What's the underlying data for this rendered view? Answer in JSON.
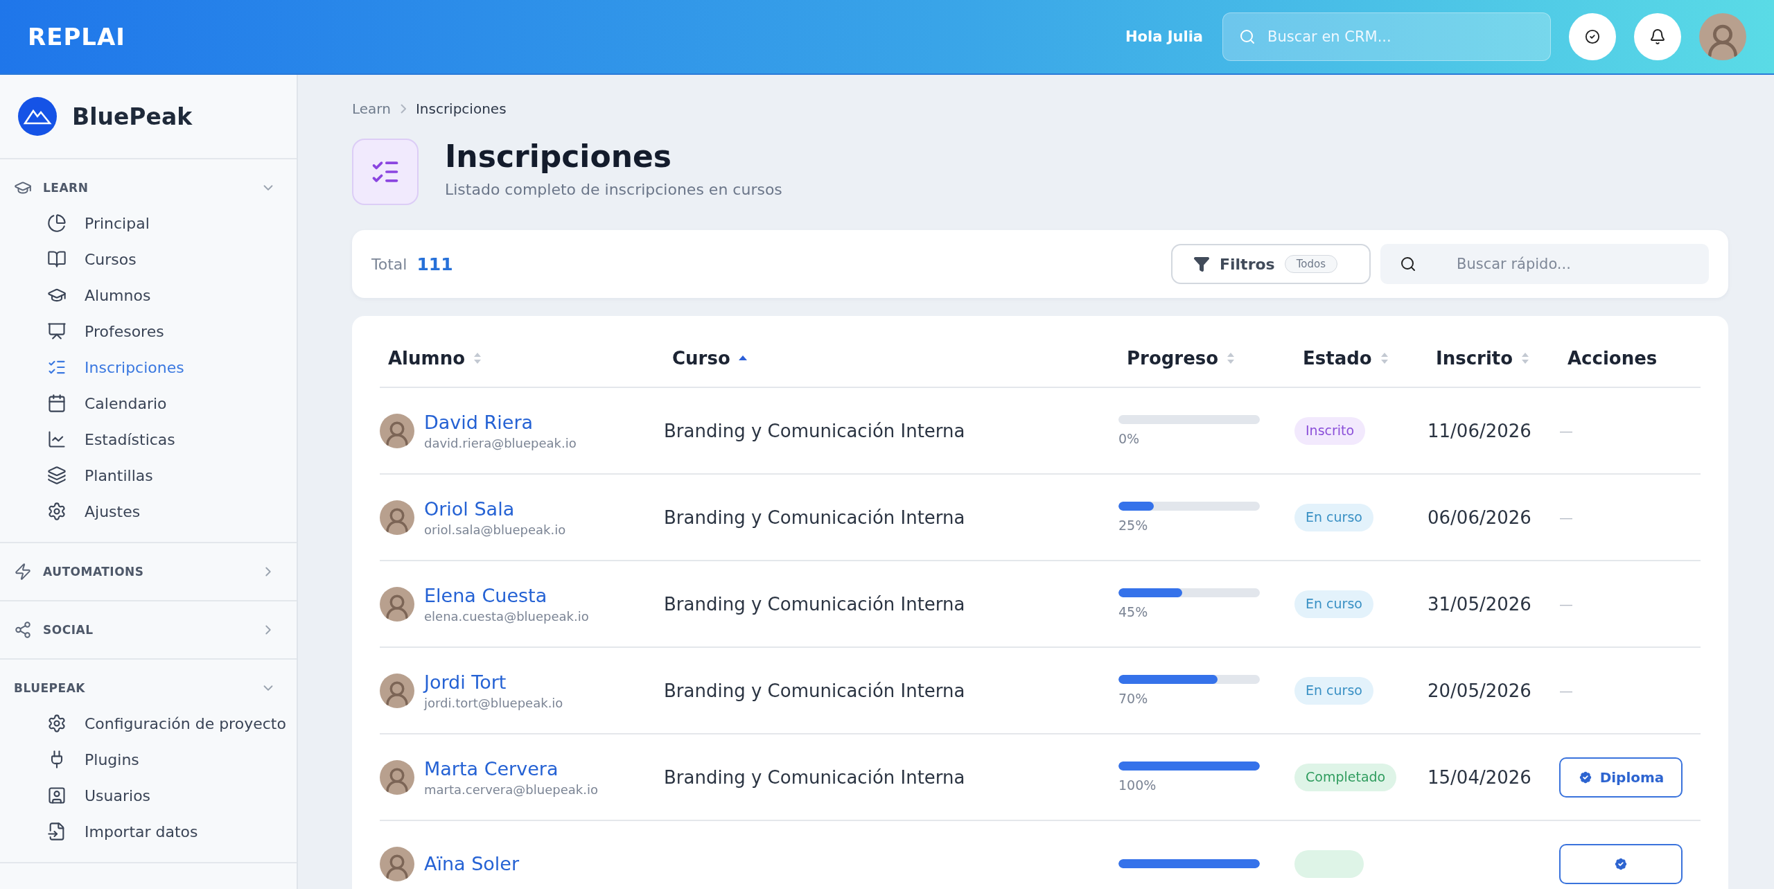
{
  "topbar": {
    "logo": "REPLAI",
    "greeting": "Hola Julia",
    "search": {
      "placeholder": "Buscar en CRM..."
    }
  },
  "sidebar": {
    "brand": "BluePeak",
    "sections": [
      {
        "title": "LEARN",
        "expanded": true,
        "items": [
          {
            "label": "Principal",
            "selected": false
          },
          {
            "label": "Cursos",
            "selected": false
          },
          {
            "label": "Alumnos",
            "selected": false
          },
          {
            "label": "Profesores",
            "selected": false
          },
          {
            "label": "Inscripciones",
            "selected": true
          },
          {
            "label": "Calendario",
            "selected": false
          },
          {
            "label": "Estadísticas",
            "selected": false
          },
          {
            "label": "Plantillas",
            "selected": false
          },
          {
            "label": "Ajustes",
            "selected": false
          }
        ]
      },
      {
        "title": "AUTOMATIONS",
        "expanded": false
      },
      {
        "title": "SOCIAL",
        "expanded": false
      },
      {
        "title": "BLUEPEAK",
        "expanded": true,
        "items": [
          {
            "label": "Configuración de proyecto",
            "selected": false
          },
          {
            "label": "Plugins",
            "selected": false
          },
          {
            "label": "Usuarios",
            "selected": false
          },
          {
            "label": "Importar datos",
            "selected": false
          }
        ]
      }
    ]
  },
  "breadcrumb": [
    "Learn",
    "Inscripciones"
  ],
  "page": {
    "title": "Inscripciones",
    "subtitle": "Listado completo de inscripciones en cursos"
  },
  "toolbar": {
    "total_label": "Total",
    "total": "111",
    "filter_label": "Filtros",
    "filter_badge": "Todos",
    "search": {
      "placeholder": "Buscar rápido..."
    }
  },
  "table": {
    "columns": [
      {
        "label": "Alumno",
        "sorted": false
      },
      {
        "label": "Curso",
        "sorted": true
      },
      {
        "label": "Progreso",
        "sorted": false
      },
      {
        "label": "Estado",
        "sorted": false
      },
      {
        "label": "Inscrito",
        "sorted": false
      },
      {
        "label": "Acciones"
      }
    ],
    "rows": [
      {
        "name": "David Riera",
        "email": "david.riera@bluepeak.io",
        "course": "Branding y Comunicación Interna",
        "level": 0,
        "progress": "0%",
        "status": {
          "kind": "enrolled",
          "label": "Inscrito"
        },
        "date": "11/06/2026",
        "action": {
          "kind": "none",
          "label": "—"
        }
      },
      {
        "name": "Oriol Sala",
        "email": "oriol.sala@bluepeak.io",
        "course": "Branding y Comunicación Interna",
        "level": 0.25,
        "progress": "25%",
        "status": {
          "kind": "active",
          "label": "En curso"
        },
        "date": "06/06/2026",
        "action": {
          "kind": "none",
          "label": "—"
        }
      },
      {
        "name": "Elena Cuesta",
        "email": "elena.cuesta@bluepeak.io",
        "course": "Branding y Comunicación Interna",
        "level": 0.45,
        "progress": "45%",
        "status": {
          "kind": "active",
          "label": "En curso"
        },
        "date": "31/05/2026",
        "action": {
          "kind": "none",
          "label": "—"
        }
      },
      {
        "name": "Jordi Tort",
        "email": "jordi.tort@bluepeak.io",
        "course": "Branding y Comunicación Interna",
        "level": 0.7,
        "progress": "70%",
        "status": {
          "kind": "active",
          "label": "En curso"
        },
        "date": "20/05/2026",
        "action": {
          "kind": "none",
          "label": "—"
        }
      },
      {
        "name": "Marta Cervera",
        "email": "marta.cervera@bluepeak.io",
        "course": "Branding y Comunicación Interna",
        "level": 1,
        "progress": "100%",
        "status": {
          "kind": "done",
          "label": "Completado"
        },
        "date": "15/04/2026",
        "action": {
          "kind": "diploma",
          "label": "Diploma"
        }
      },
      {
        "name": "Aïna Soler",
        "level": 1,
        "status": {
          "kind": "done"
        },
        "action": {
          "kind": "diploma"
        }
      }
    ]
  }
}
